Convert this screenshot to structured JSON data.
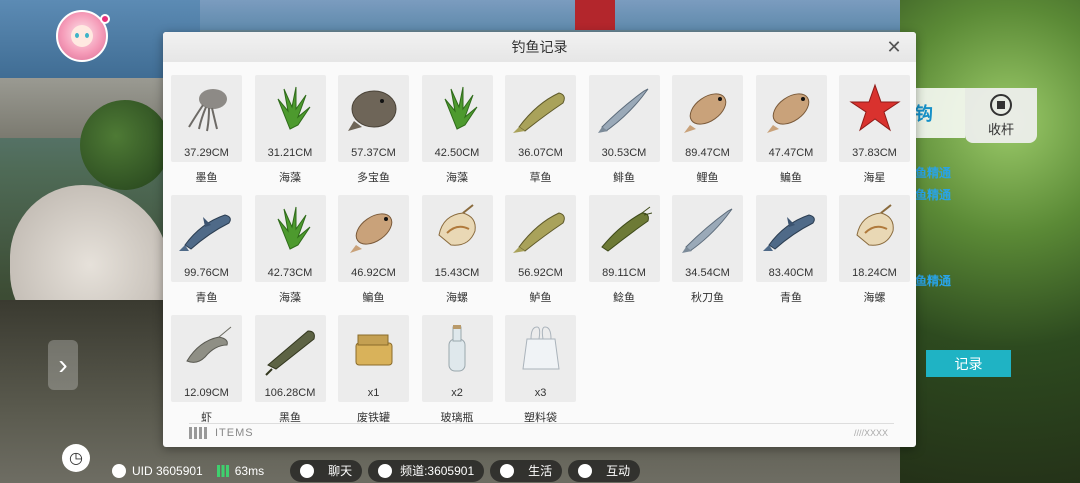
{
  "modal": {
    "title": "钓鱼记录",
    "close_icon": "close-icon"
  },
  "catches": [
    {
      "name": "墨鱼",
      "value": "37.29CM",
      "icon": "squid-icon"
    },
    {
      "name": "海藻",
      "value": "31.21CM",
      "icon": "seaweed-icon"
    },
    {
      "name": "多宝鱼",
      "value": "57.37CM",
      "icon": "turbot-icon"
    },
    {
      "name": "海藻",
      "value": "42.50CM",
      "icon": "seaweed-icon"
    },
    {
      "name": "草鱼",
      "value": "36.07CM",
      "icon": "grass-carp-icon"
    },
    {
      "name": "鲱鱼",
      "value": "30.53CM",
      "icon": "herring-icon"
    },
    {
      "name": "鲤鱼",
      "value": "89.47CM",
      "icon": "carp-icon"
    },
    {
      "name": "鳊鱼",
      "value": "47.47CM",
      "icon": "bream-icon"
    },
    {
      "name": "海星",
      "value": "37.83CM",
      "icon": "starfish-icon"
    },
    {
      "name": "青鱼",
      "value": "99.76CM",
      "icon": "black-carp-icon"
    },
    {
      "name": "海藻",
      "value": "42.73CM",
      "icon": "seaweed-icon"
    },
    {
      "name": "鳊鱼",
      "value": "46.92CM",
      "icon": "bream-icon"
    },
    {
      "name": "海螺",
      "value": "15.43CM",
      "icon": "conch-icon"
    },
    {
      "name": "鲈鱼",
      "value": "56.92CM",
      "icon": "perch-icon"
    },
    {
      "name": "鲶鱼",
      "value": "89.11CM",
      "icon": "catfish-icon"
    },
    {
      "name": "秋刀鱼",
      "value": "34.54CM",
      "icon": "saury-icon"
    },
    {
      "name": "青鱼",
      "value": "83.40CM",
      "icon": "black-carp-icon"
    },
    {
      "name": "海螺",
      "value": "18.24CM",
      "icon": "conch-icon"
    },
    {
      "name": "虾",
      "value": "12.09CM",
      "icon": "shrimp-icon"
    },
    {
      "name": "黑鱼",
      "value": "106.28CM",
      "icon": "snakehead-icon"
    },
    {
      "name": "废铁罐",
      "value": "x1",
      "icon": "tin-can-icon"
    },
    {
      "name": "玻璃瓶",
      "value": "x2",
      "icon": "glass-bottle-icon"
    },
    {
      "name": "塑料袋",
      "value": "x3",
      "icon": "plastic-bag-icon"
    }
  ],
  "footer": {
    "logo_text": "ITEMS",
    "tag_text": "////XXXX"
  },
  "side": {
    "hook_text": "钩",
    "reel_label": "收杆",
    "log_lines": [
      "鱼精通",
      "鱼精通",
      "鱼精通"
    ],
    "record_label": "记录"
  },
  "status": {
    "uid": "UID 3605901",
    "ping": "63ms",
    "chat_label": "聊天",
    "channel_label": "频道:3605901",
    "life_label": "生活",
    "interact_label": "互动"
  }
}
